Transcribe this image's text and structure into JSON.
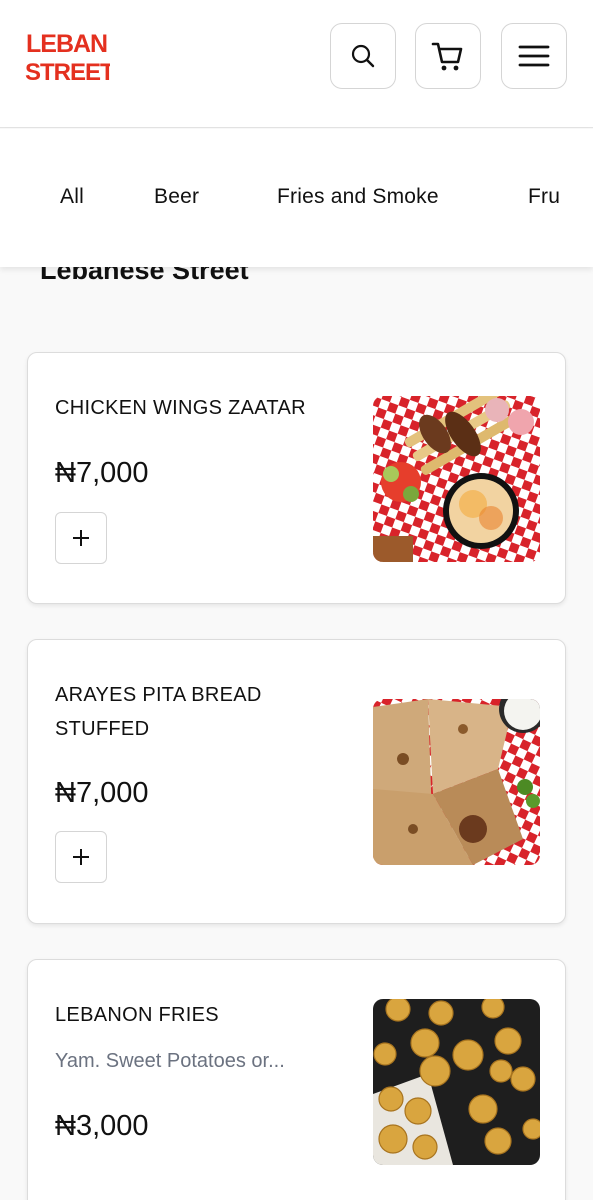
{
  "header": {
    "logo_text": [
      "LEBAN",
      "STREET"
    ],
    "brand_color": "#e4301f",
    "icons": [
      "search-icon",
      "cart-icon",
      "menu-icon"
    ]
  },
  "categories": [
    "All",
    "Beer",
    "Fries and Smoke",
    "Fru"
  ],
  "section_title": "Lebanese Street",
  "products": [
    {
      "name": "CHICKEN WINGS ZAATAR",
      "description": "",
      "price": "₦7,000",
      "add_label": "+"
    },
    {
      "name": "ARAYES PITA BREAD STUFFED",
      "description": "",
      "price": "₦7,000",
      "add_label": "+"
    },
    {
      "name": "LEBANON FRIES",
      "description": "Yam. Sweet Potatoes or...",
      "price": "₦3,000"
    }
  ]
}
